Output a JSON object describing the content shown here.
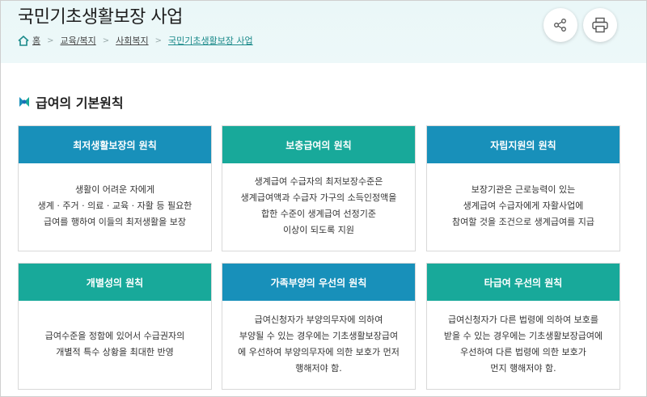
{
  "header": {
    "title": "국민기초생활보장 사업",
    "breadcrumb": [
      "홈",
      "교육/복지",
      "사회복지",
      "국민기초생활보장 사업"
    ]
  },
  "toolbar": {
    "share_icon": "share-icon",
    "print_icon": "print-icon"
  },
  "section": {
    "title": "급여의 기본원칙"
  },
  "colors": {
    "teal": "#18a99a",
    "blue": "#1890ba"
  },
  "cards": [
    {
      "title": "최저생활보장의 원칙",
      "color": "blue",
      "lines": [
        "생활이 어려운 자에게",
        "생계 · 주거 · 의료 · 교육 · 자활 등 필요한",
        "급여를 행하여 이들의 최저생활을 보장"
      ]
    },
    {
      "title": "보충급여의 원칙",
      "color": "teal",
      "lines": [
        "생계급여 수급자의 최저보장수준은",
        "생계급여액과 수급자 가구의 소득인정액을",
        "합한 수준이 생계급여 선정기준",
        "이상이 되도록 지원"
      ]
    },
    {
      "title": "자립지원의 원칙",
      "color": "blue",
      "lines": [
        "보장기관은 근로능력이 있는",
        "생계급여 수급자에게 자활사업에",
        "참여할 것을 조건으로 생계급여를 지급"
      ]
    },
    {
      "title": "개별성의 원칙",
      "color": "teal",
      "lines": [
        "급여수준을 정함에 있어서 수급권자의",
        "개별적 특수 상황을 최대한 반영"
      ]
    },
    {
      "title": "가족부양의 우선의 원칙",
      "color": "blue",
      "lines": [
        "급여신청자가 부양의무자에 의하여",
        "부양될 수 있는 경우에는 기초생활보장급여",
        "에 우선하여 부양의무자에 의한 보호가 먼저",
        "행해저야 함."
      ]
    },
    {
      "title": "타급여 우선의 원칙",
      "color": "teal",
      "lines": [
        "급여신청자가 다른 법령에 의하여 보호를",
        "받을 수 있는 경우에는 기초생활보장급여에",
        "우선하여 다른 법령에 의한 보호가",
        "먼지 행해저야 함."
      ]
    }
  ]
}
